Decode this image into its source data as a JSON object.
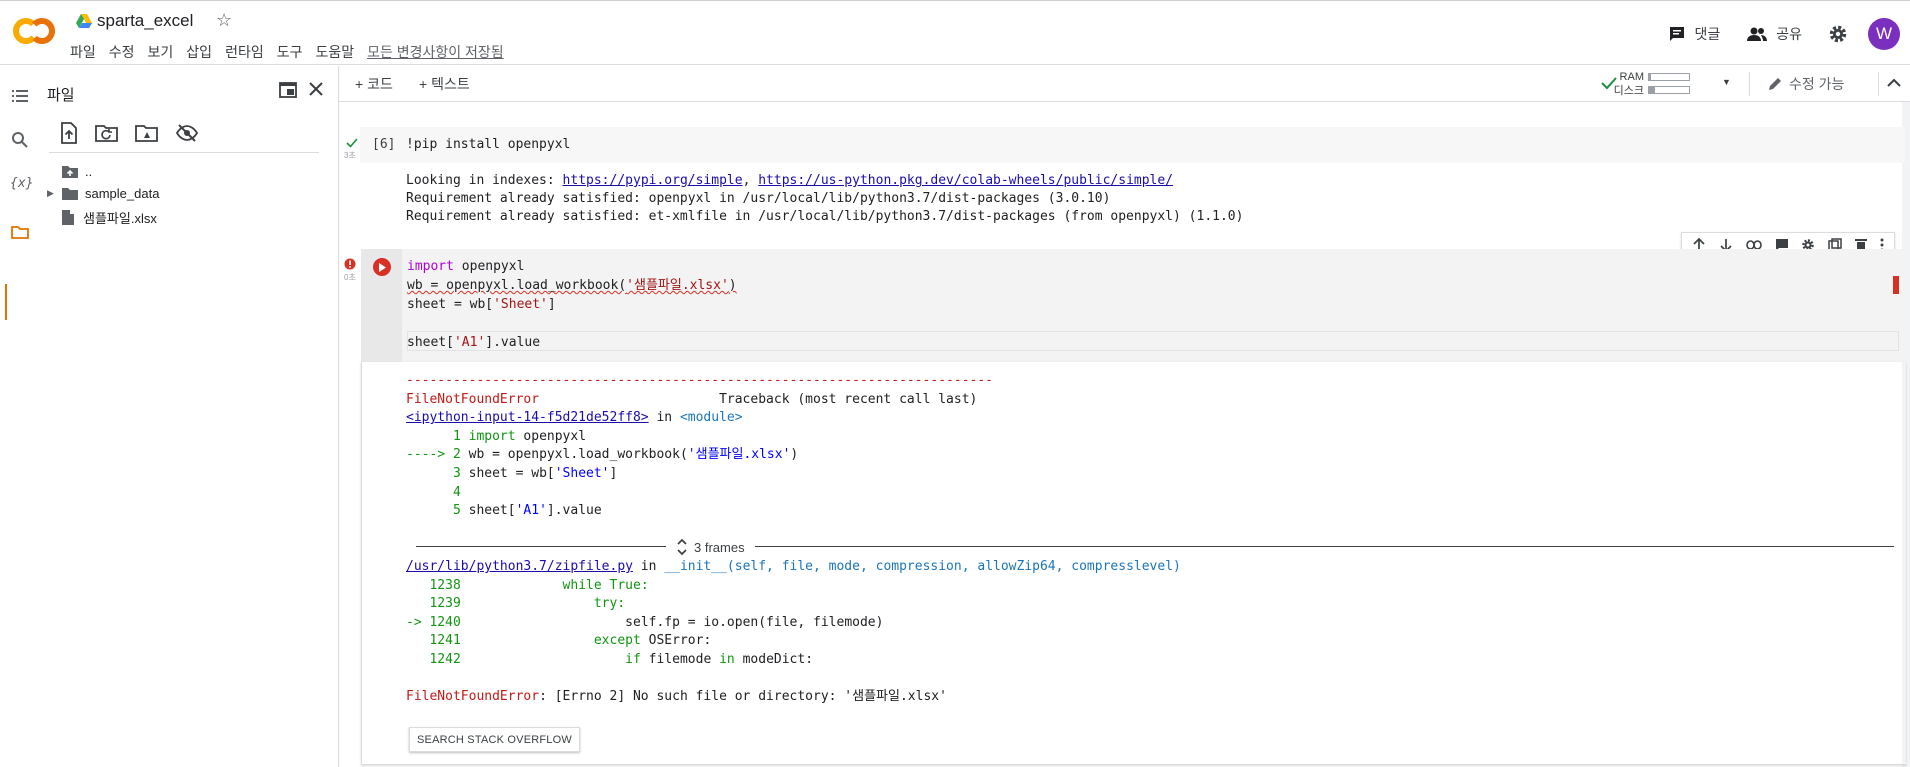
{
  "header": {
    "doc_title": "sparta_excel",
    "menu": [
      "파일",
      "수정",
      "보기",
      "삽입",
      "런타임",
      "도구",
      "도움말"
    ],
    "saved_status": "모든 변경사항이 저장됨",
    "comment_label": "댓글",
    "share_label": "공유",
    "avatar_letter": "W"
  },
  "files_panel": {
    "title": "파일",
    "tree": [
      {
        "name": ".."
      },
      {
        "name": "sample_data"
      },
      {
        "name": "샘플파일.xlsx"
      }
    ]
  },
  "nb_toolbar": {
    "add_code": "+ 코드",
    "add_text": "+ 텍스트",
    "ram_label": "RAM",
    "disk_label": "디스크",
    "ram_fill": 0.05,
    "disk_fill": 0.15,
    "edit_label": "수정 가능"
  },
  "cell1": {
    "exec_count": "[6]",
    "time": "3초",
    "code": "!pip install openpyxl",
    "output": {
      "indexes_prefix": "Looking in indexes: ",
      "link1": "https://pypi.org/simple",
      "sep": ", ",
      "link2": "https://us-python.pkg.dev/colab-wheels/public/simple/",
      "line2": "Requirement already satisfied: openpyxl in /usr/local/lib/python3.7/dist-packages (3.0.10)",
      "line3": "Requirement already satisfied: et-xmlfile in /usr/local/lib/python3.7/dist-packages (from openpyxl) (1.1.0)"
    }
  },
  "cell2": {
    "time": "0초",
    "code": {
      "l1_kw": "import",
      "l1_rest": " openpyxl",
      "l2_a": "wb = openpyxl.load_workbook(",
      "l2_str": "'샘플파일.xlsx'",
      "l2_b": ")",
      "l3_a": "sheet = wb[",
      "l3_str": "'Sheet'",
      "l3_b": "]",
      "l5_a": "sheet[",
      "l5_str": "'A1'",
      "l5_b": "].value"
    }
  },
  "traceback": {
    "dashes": "---------------------------------------------------------------------------",
    "error_name": "FileNotFoundError",
    "traceback_header": "                       Traceback (most recent call last)",
    "input_link": "<ipython-input-14-f5d21de52ff8>",
    "in_word": " in ",
    "module": "<module>",
    "src": [
      {
        "num": "      1 ",
        "kw": "import",
        "rest": " openpyxl"
      },
      {
        "num": "----> 2 ",
        "kw": "",
        "rest": "wb = openpyxl.load_workbook(",
        "str": "'샘플파일.xlsx'",
        "tail": ")"
      },
      {
        "num": "      3 ",
        "kw": "",
        "rest": "sheet = wb[",
        "str": "'Sheet'",
        "tail": "]"
      },
      {
        "num": "      4",
        "kw": "",
        "rest": ""
      },
      {
        "num": "      5 ",
        "kw": "",
        "rest": "sheet[",
        "str": "'A1'",
        "tail": "].value"
      }
    ],
    "frames_label": "3 frames",
    "zip_link": "/usr/lib/python3.7/zipfile.py",
    "zip_in": " in ",
    "zip_func": "__init__(self, file, mode, compression, allowZip64, compresslevel)",
    "zip_src": [
      {
        "num": "   1238 ",
        "code": "            ",
        "kw": "while",
        "rest": " True:"
      },
      {
        "num": "   1239 ",
        "code": "                ",
        "kw": "try:",
        "rest": ""
      },
      {
        "num": "-> 1240 ",
        "code": "                    ",
        "kw": "",
        "rest": "self.fp = io.open(file, filemode)"
      },
      {
        "num": "   1241 ",
        "code": "                ",
        "kw": "except",
        "rest": " OSError:"
      },
      {
        "num": "   1242 ",
        "code": "                    ",
        "kw": "if",
        "rest": " filemode ",
        "kw2": "in",
        "rest2": " modeDict:"
      }
    ],
    "final_error_name": "FileNotFoundError",
    "final_error_msg": ": [Errno 2] No such file or directory: '샘플파일.xlsx'",
    "so_button": "SEARCH STACK OVERFLOW"
  }
}
